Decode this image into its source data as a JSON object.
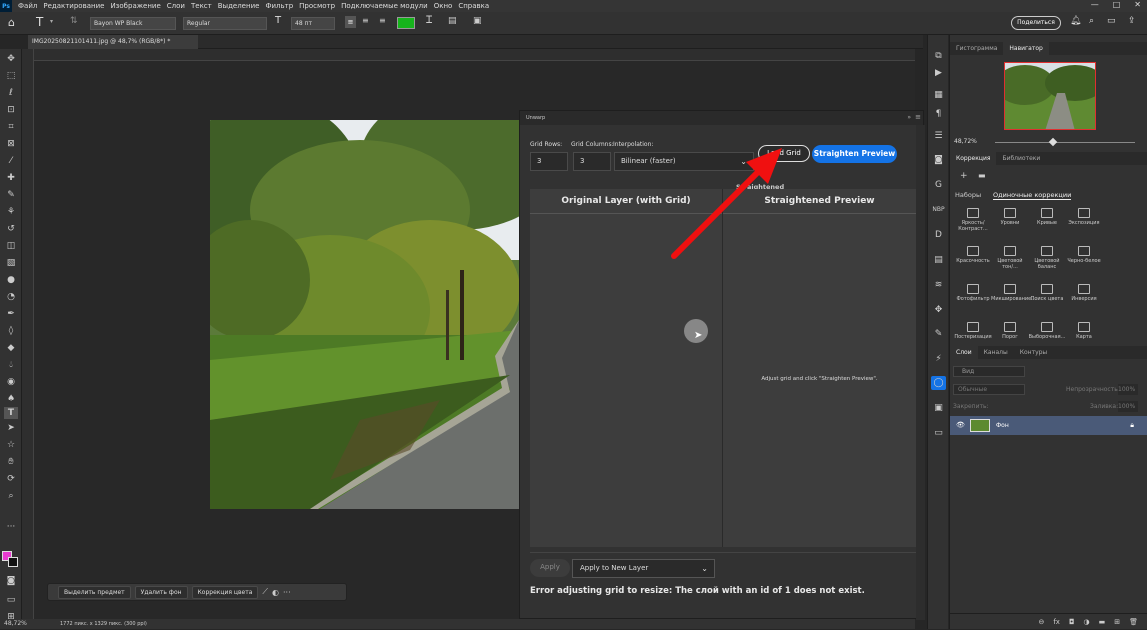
{
  "menubar": {
    "logo": "Ps",
    "items": [
      "Файл",
      "Редактирование",
      "Изображение",
      "Слои",
      "Текст",
      "Выделение",
      "Фильтр",
      "Просмотр",
      "Подключаемые модули",
      "Окно",
      "Справка"
    ],
    "window_controls": [
      "—",
      "□",
      "✕"
    ]
  },
  "options_bar": {
    "font_family": "Bayon WP Black",
    "font_style": "Regular",
    "font_size": "48 пт",
    "text_color": "#16b41c",
    "share_label": "Поделиться"
  },
  "document": {
    "tab_title": "IMG20250821101411.jpg @ 48,7% (RGB/8*) *",
    "status": "48,72%",
    "status_info": "1772 пикс. x 1329 пикс. (300 ppi)"
  },
  "context_bar": {
    "select_subject": "Выделить предмет",
    "remove_bg": "Удалить фон",
    "color_correction": "Коррекция цвета"
  },
  "unwarp": {
    "panel_title": "Unwarp",
    "grid_rows_label": "Grid Rows:",
    "grid_rows_value": "3",
    "grid_cols_label": "Grid Columns:",
    "grid_cols_value": "3",
    "interp_label": "Interpolation:",
    "interp_value": "Bilinear (faster)",
    "load_grid_label": "Load Grid",
    "straighten_label": "Straighten Preview",
    "straightened_label": "Straightened",
    "original_title": "Original Layer (with Grid)",
    "preview_title": "Straightened Preview",
    "hint": "Adjust grid and click \"Straighten Preview\".",
    "apply_label": "Apply",
    "apply_target": "Apply to New Layer",
    "error_text": "Error adjusting grid to resize: The слой with an id of 1 does not exist."
  },
  "right_panel": {
    "nav_tabs": [
      "Гистограмма",
      "Навигатор"
    ],
    "zoom": "48,72%",
    "adj_tabs": [
      "Коррекция",
      "Библиотеки"
    ],
    "sub_tabs": [
      "Наборы",
      "Одиночные коррекции"
    ],
    "adjustments": [
      "Яркость/Контраст...",
      "Уровни",
      "Кривые",
      "Экспозиция",
      "Красочность",
      "Цветовой тон/...",
      "Цветовой баланс",
      "Черно-белое",
      "Фотофильтр",
      "Микширование...",
      "Поиск цвета",
      "Инверсия",
      "Постеризация",
      "Порог",
      "Выборочная...",
      "Карта"
    ],
    "layer_tabs": [
      "Слои",
      "Каналы",
      "Контуры"
    ],
    "layer_search": "Вид",
    "blend_mode": "Обычные",
    "opacity_label": "Непрозрачность:",
    "opacity_value": "100%",
    "lock_label": "Закрепить:",
    "fill_label": "Заливка:",
    "fill_value": "100%",
    "layer_name": "Фон"
  }
}
